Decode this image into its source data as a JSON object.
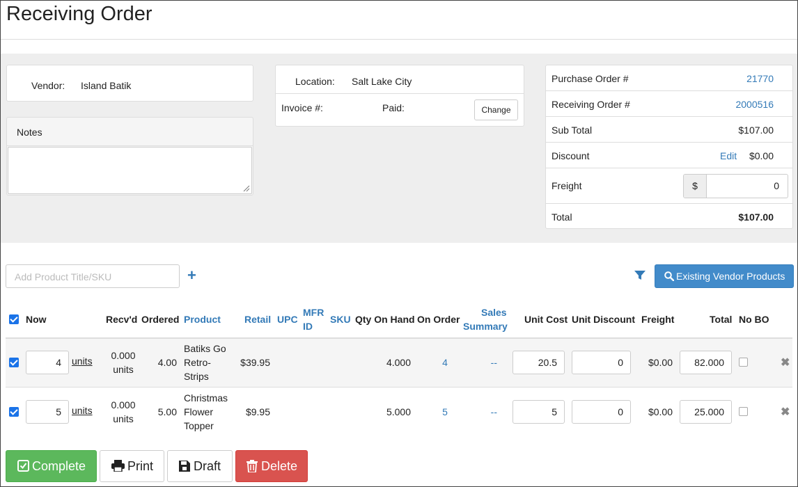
{
  "page": {
    "title": "Receiving Order"
  },
  "vendor": {
    "label": "Vendor:",
    "value": "Island Batik"
  },
  "notes": {
    "label": "Notes",
    "value": ""
  },
  "location": {
    "label": "Location:",
    "value": "Salt Lake City",
    "invoice_label": "Invoice #:",
    "paid_label": "Paid:",
    "change_label": "Change"
  },
  "summary": {
    "po_label": "Purchase Order #",
    "po_value": "21770",
    "ro_label": "Receiving Order #",
    "ro_value": "2000516",
    "subtotal_label": "Sub Total",
    "subtotal_value": "$107.00",
    "discount_label": "Discount",
    "discount_edit": "Edit",
    "discount_value": "$0.00",
    "freight_label": "Freight",
    "freight_addon": "$",
    "freight_value": "0",
    "total_label": "Total",
    "total_value": "$107.00"
  },
  "toolbar": {
    "add_placeholder": "Add Product Title/SKU",
    "plus": "+",
    "existing_label": "Existing Vendor Products"
  },
  "table": {
    "headers": {
      "now": "Now",
      "recvd": "Recv'd",
      "ordered": "Ordered",
      "product": "Product",
      "retail": "Retail",
      "upc": "UPC",
      "mfr1": "MFR",
      "mfr2": "ID",
      "sku": "SKU",
      "qty_on_hand": "Qty On Hand",
      "on_order": "On Order",
      "sales1": "Sales",
      "sales2": "Summary",
      "unit_cost": "Unit Cost",
      "unit_discount": "Unit Discount",
      "freight": "Freight",
      "total": "Total",
      "no_bo": "No BO"
    },
    "rows": [
      {
        "checked": true,
        "now": "4",
        "units": "units",
        "recvd1": "0.000",
        "recvd2": "units",
        "ordered": "4.00",
        "product1": "Batiks Go",
        "product2": "Retro-",
        "product3": "Strips",
        "retail": "$39.95",
        "qty_on_hand": "4.000",
        "on_order": "4",
        "sales": "--",
        "unit_cost": "20.5",
        "unit_discount": "0",
        "freight": "$0.00",
        "total": "82.000",
        "no_bo": false
      },
      {
        "checked": true,
        "now": "5",
        "units": "units",
        "recvd1": "0.000",
        "recvd2": "units",
        "ordered": "5.00",
        "product1": "Christmas",
        "product2": "Flower",
        "product3": "Topper",
        "retail": "$9.95",
        "qty_on_hand": "5.000",
        "on_order": "5",
        "sales": "--",
        "unit_cost": "5",
        "unit_discount": "0",
        "freight": "$0.00",
        "total": "25.000",
        "no_bo": false
      }
    ]
  },
  "actions": {
    "complete": "Complete",
    "print": "Print",
    "draft": "Draft",
    "delete": "Delete"
  },
  "colors": {
    "accent": "#337ab7",
    "primary_button": "#428bca",
    "success": "#5cb85c",
    "danger": "#d9534f"
  },
  "icons": {
    "plus": "plus-icon",
    "filter": "filter-icon",
    "search": "search-icon",
    "remove": "close-icon",
    "check": "checkbox-icon",
    "print": "printer-icon",
    "draft": "floppy-disk-icon",
    "delete": "trash-icon"
  }
}
